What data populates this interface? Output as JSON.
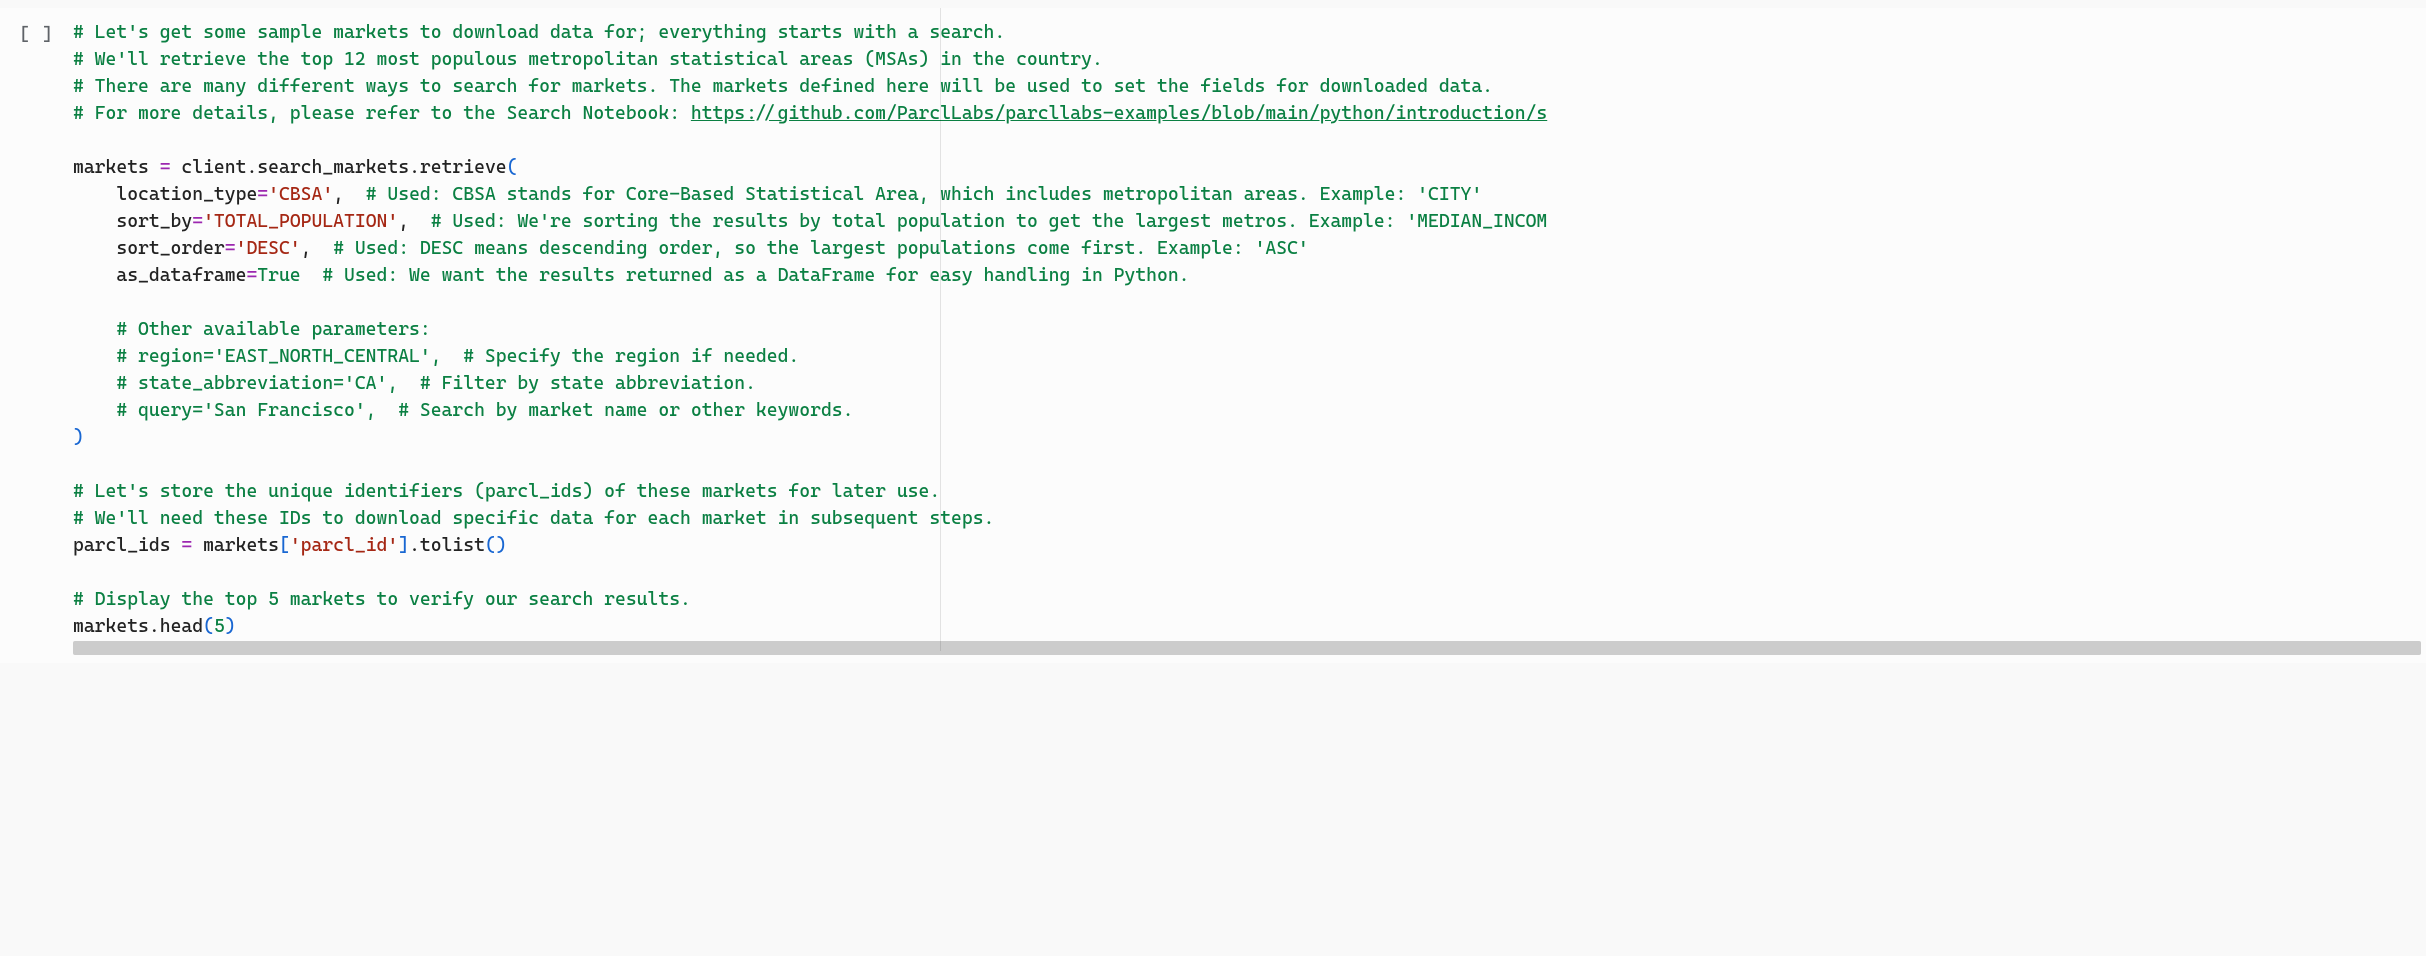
{
  "cell": {
    "prompt": "[ ]",
    "tokens": [
      [
        {
          "t": "comment",
          "v": "# Let's get some sample markets to download data for; everything starts with a search."
        }
      ],
      [
        {
          "t": "comment",
          "v": "# We'll retrieve the top 12 most populous metropolitan statistical areas (MSAs) in the country."
        }
      ],
      [
        {
          "t": "comment",
          "v": "# There are many different ways to search for markets. The markets defined here will be used to set the fields for downloaded data."
        }
      ],
      [
        {
          "t": "comment",
          "v": "# For more details, please refer to the Search Notebook: "
        },
        {
          "t": "link",
          "v": "https://github.com/ParclLabs/parcllabs-examples/blob/main/python/introduction/s"
        }
      ],
      [
        {
          "t": "blank",
          "v": ""
        }
      ],
      [
        {
          "t": "name",
          "v": "markets "
        },
        {
          "t": "op",
          "v": "="
        },
        {
          "t": "name",
          "v": " client"
        },
        {
          "t": "punct",
          "v": "."
        },
        {
          "t": "name",
          "v": "search_markets"
        },
        {
          "t": "punct",
          "v": "."
        },
        {
          "t": "name",
          "v": "retrieve"
        },
        {
          "t": "paren",
          "v": "("
        }
      ],
      [
        {
          "t": "name",
          "v": "    location_type"
        },
        {
          "t": "op",
          "v": "="
        },
        {
          "t": "string",
          "v": "'CBSA'"
        },
        {
          "t": "punct",
          "v": ",  "
        },
        {
          "t": "comment",
          "v": "# Used: CBSA stands for Core-Based Statistical Area, which includes metropolitan areas. Example: 'CITY'"
        }
      ],
      [
        {
          "t": "name",
          "v": "    sort_by"
        },
        {
          "t": "op",
          "v": "="
        },
        {
          "t": "string",
          "v": "'TOTAL_POPULATION'"
        },
        {
          "t": "punct",
          "v": ",  "
        },
        {
          "t": "comment",
          "v": "# Used: We're sorting the results by total population to get the largest metros. Example: 'MEDIAN_INCOM"
        }
      ],
      [
        {
          "t": "name",
          "v": "    sort_order"
        },
        {
          "t": "op",
          "v": "="
        },
        {
          "t": "string",
          "v": "'DESC'"
        },
        {
          "t": "punct",
          "v": ",  "
        },
        {
          "t": "comment",
          "v": "# Used: DESC means descending order, so the largest populations come first. Example: 'ASC'"
        }
      ],
      [
        {
          "t": "name",
          "v": "    as_dataframe"
        },
        {
          "t": "op",
          "v": "="
        },
        {
          "t": "bool",
          "v": "True"
        },
        {
          "t": "name",
          "v": "  "
        },
        {
          "t": "comment",
          "v": "# Used: We want the results returned as a DataFrame for easy handling in Python."
        }
      ],
      [
        {
          "t": "blank",
          "v": ""
        }
      ],
      [
        {
          "t": "name",
          "v": "    "
        },
        {
          "t": "comment",
          "v": "# Other available parameters:"
        }
      ],
      [
        {
          "t": "name",
          "v": "    "
        },
        {
          "t": "comment",
          "v": "# region='EAST_NORTH_CENTRAL',  # Specify the region if needed."
        }
      ],
      [
        {
          "t": "name",
          "v": "    "
        },
        {
          "t": "comment",
          "v": "# state_abbreviation='CA',  # Filter by state abbreviation."
        }
      ],
      [
        {
          "t": "name",
          "v": "    "
        },
        {
          "t": "comment",
          "v": "# query='San Francisco',  # Search by market name or other keywords."
        }
      ],
      [
        {
          "t": "paren",
          "v": ")"
        }
      ],
      [
        {
          "t": "blank",
          "v": ""
        }
      ],
      [
        {
          "t": "comment",
          "v": "# Let's store the unique identifiers (parcl_ids) of these markets for later use."
        }
      ],
      [
        {
          "t": "comment",
          "v": "# We'll need these IDs to download specific data for each market in subsequent steps."
        }
      ],
      [
        {
          "t": "name",
          "v": "parcl_ids "
        },
        {
          "t": "op",
          "v": "="
        },
        {
          "t": "name",
          "v": " markets"
        },
        {
          "t": "bracket",
          "v": "["
        },
        {
          "t": "string",
          "v": "'parcl_id'"
        },
        {
          "t": "bracket",
          "v": "]"
        },
        {
          "t": "punct",
          "v": "."
        },
        {
          "t": "name",
          "v": "tolist"
        },
        {
          "t": "paren",
          "v": "()"
        }
      ],
      [
        {
          "t": "blank",
          "v": ""
        }
      ],
      [
        {
          "t": "comment",
          "v": "# Display the top 5 markets to verify our search results."
        }
      ],
      [
        {
          "t": "name",
          "v": "markets"
        },
        {
          "t": "punct",
          "v": "."
        },
        {
          "t": "name",
          "v": "head"
        },
        {
          "t": "paren",
          "v": "("
        },
        {
          "t": "number",
          "v": "5"
        },
        {
          "t": "paren",
          "v": ")"
        }
      ]
    ]
  }
}
